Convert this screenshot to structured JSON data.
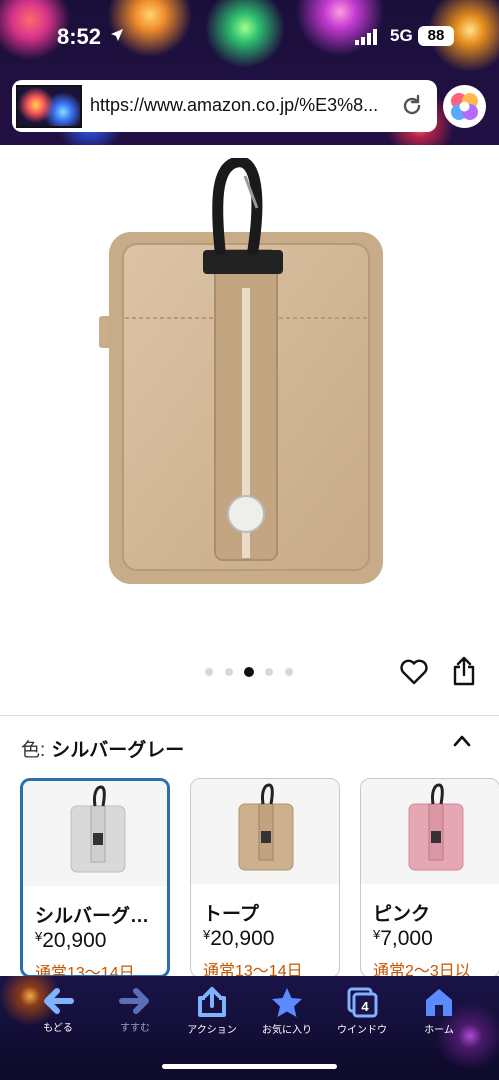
{
  "status": {
    "time": "8:52",
    "network": "5G",
    "battery": "88"
  },
  "browser": {
    "url": "https://www.amazon.co.jp/%E3%8..."
  },
  "carousel": {
    "dot_count": 5,
    "active_index": 2
  },
  "color_selector": {
    "label": "色:",
    "selected": "シルバーグレー"
  },
  "variants": [
    {
      "name": "シルバーグ…",
      "price": "20,900",
      "currency": "¥",
      "shipping": "通常13～14日",
      "color": "#d9d9d9"
    },
    {
      "name": "トープ",
      "price": "20,900",
      "currency": "¥",
      "shipping": "通常13～14日",
      "color": "#cdb08e"
    },
    {
      "name": "ピンク",
      "price": "7,000",
      "currency": "¥",
      "shipping": "通常2～3日以",
      "color": "#e6a7b4"
    }
  ],
  "toolbar": {
    "back": "もどる",
    "forward": "すすむ",
    "action": "アクション",
    "favorites": "お気に入り",
    "windows": "ウインドウ",
    "windows_count": "4",
    "home": "ホーム"
  },
  "colors": {
    "accent": "#2a6fad",
    "shipping": "#c45500",
    "product": "#d3b896"
  }
}
